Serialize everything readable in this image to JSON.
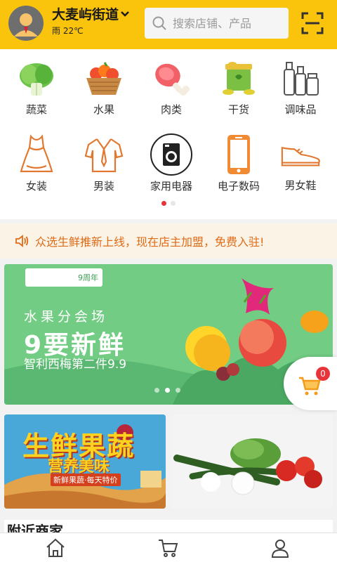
{
  "header": {
    "location": "大麦屿街道",
    "weather": "雨 22℃",
    "search_placeholder": "搜索店铺、产品",
    "bg_color": "#fac40c"
  },
  "categories": [
    {
      "label": "蔬菜",
      "icon": "lettuce-icon"
    },
    {
      "label": "水果",
      "icon": "fruit-basket-icon"
    },
    {
      "label": "肉类",
      "icon": "meat-icon"
    },
    {
      "label": "干货",
      "icon": "dry-goods-icon"
    },
    {
      "label": "调味品",
      "icon": "condiment-bottles-icon"
    },
    {
      "label": "女装",
      "icon": "dress-icon"
    },
    {
      "label": "男装",
      "icon": "shirt-icon"
    },
    {
      "label": "家用电器",
      "icon": "washing-machine-icon"
    },
    {
      "label": "电子数码",
      "icon": "phone-icon"
    },
    {
      "label": "男女鞋",
      "icon": "shoe-icon"
    }
  ],
  "notice": {
    "text": "众选生鲜推新上线，现在店主加盟，免费入驻!",
    "color": "#e06a16"
  },
  "banner": {
    "tag": "9周年",
    "line1": "水果分会场",
    "line2": "9要新鲜",
    "line3": "智利西梅第二件9.9"
  },
  "cart": {
    "badge": "0"
  },
  "promo_left": {
    "title": "生鲜果蔬",
    "subtitle": "营养美味",
    "tagline": "新鲜果蔬·每天特价"
  },
  "nearby": {
    "title": "附近商家"
  },
  "accent": "#e8333a"
}
